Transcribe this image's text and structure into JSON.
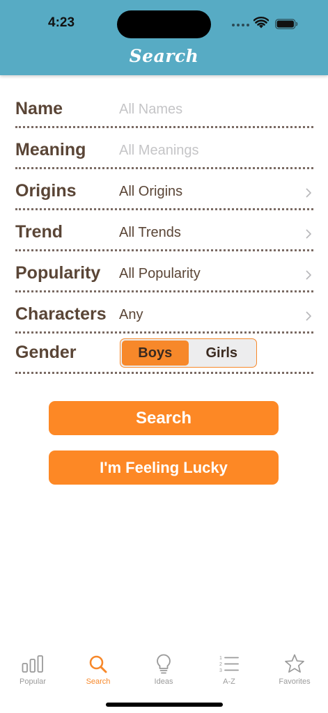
{
  "status_bar": {
    "time": "4:23"
  },
  "header": {
    "title": "Search"
  },
  "form": {
    "rows": [
      {
        "label": "Name",
        "value": "All Names"
      },
      {
        "label": "Meaning",
        "value": "All Meanings"
      },
      {
        "label": "Origins",
        "value": "All Origins"
      },
      {
        "label": "Trend",
        "value": "All Trends"
      },
      {
        "label": "Popularity",
        "value": "All Popularity"
      },
      {
        "label": "Characters",
        "value": "Any"
      }
    ],
    "gender": {
      "label": "Gender",
      "options": [
        "Boys",
        "Girls"
      ],
      "selected": "Boys"
    }
  },
  "actions": {
    "search_label": "Search",
    "lucky_label": "I'm Feeling Lucky"
  },
  "tabbar": {
    "items": [
      {
        "label": "Popular",
        "icon": "bar-chart-icon"
      },
      {
        "label": "Search",
        "icon": "search-icon"
      },
      {
        "label": "Ideas",
        "icon": "lightbulb-icon"
      },
      {
        "label": "A-Z",
        "icon": "numbered-list-icon"
      },
      {
        "label": "Favorites",
        "icon": "star-icon"
      }
    ],
    "active": "Search"
  },
  "colors": {
    "header": "#57abc4",
    "accent": "#f7882a",
    "label_text": "#5a4536",
    "placeholder": "#c5c5c7"
  }
}
